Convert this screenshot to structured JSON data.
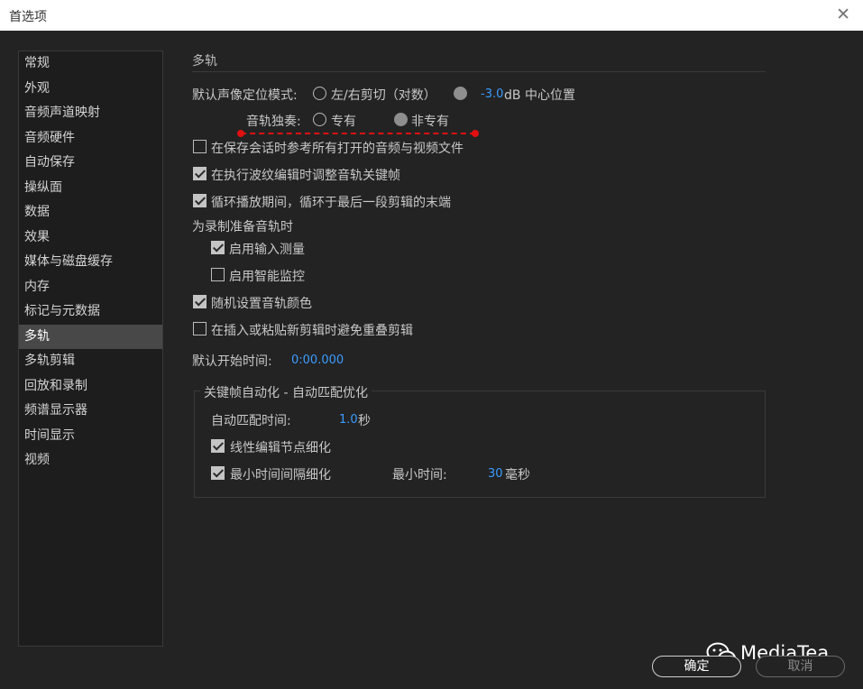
{
  "window": {
    "title": "首选项"
  },
  "sidebar": {
    "items": [
      {
        "label": "常规"
      },
      {
        "label": "外观"
      },
      {
        "label": "音频声道映射"
      },
      {
        "label": "音频硬件"
      },
      {
        "label": "自动保存"
      },
      {
        "label": "操纵面"
      },
      {
        "label": "数据"
      },
      {
        "label": "效果"
      },
      {
        "label": "媒体与磁盘缓存"
      },
      {
        "label": "内存"
      },
      {
        "label": "标记与元数据"
      },
      {
        "label": "多轨",
        "active": true
      },
      {
        "label": "多轨剪辑"
      },
      {
        "label": "回放和录制"
      },
      {
        "label": "频谱显示器"
      },
      {
        "label": "时间显示"
      },
      {
        "label": "视频"
      }
    ]
  },
  "main": {
    "section_title": "多轨",
    "pan_mode": {
      "label": "默认声像定位模式:",
      "option1": "左/右剪切（对数）",
      "option2_value": "-3.0",
      "option2_unit": "dB 中心位置",
      "selected": "option2"
    },
    "solo": {
      "label": "音轨独奏:",
      "option1": "专有",
      "option2": "非专有",
      "selected": "option2"
    },
    "checkboxes": {
      "save_session_ref": {
        "label": "在保存会话时参考所有打开的音频与视频文件",
        "checked": false
      },
      "ripple_edit": {
        "label": "在执行波纹编辑时调整音轨关键帧",
        "checked": true
      },
      "loop_playback": {
        "label": "循环播放期间，循环于最后一段剪辑的末端",
        "checked": true
      }
    },
    "record_prep": {
      "label": "为录制准备音轨时",
      "enable_input_meter": {
        "label": "启用输入测量",
        "checked": true
      },
      "enable_smart_monitor": {
        "label": "启用智能监控",
        "checked": false
      }
    },
    "random_track_color": {
      "label": "随机设置音轨颜色",
      "checked": true
    },
    "avoid_overlap": {
      "label": "在插入或粘贴新剪辑时避免重叠剪辑",
      "checked": false
    },
    "default_start_time": {
      "label": "默认开始时间:",
      "value": "0:00.000"
    },
    "keyframe_group": {
      "title": "关键帧自动化 - 自动匹配优化",
      "auto_match_time": {
        "label": "自动匹配时间:",
        "value": "1.0",
        "unit": "秒"
      },
      "linear_edit_refine": {
        "label": "线性编辑节点细化",
        "checked": true
      },
      "min_interval_refine": {
        "label": "最小时间间隔细化",
        "checked": true
      },
      "min_time": {
        "label": "最小时间:",
        "value": "30",
        "unit": "毫秒"
      }
    }
  },
  "footer": {
    "ok_label": "确定",
    "cancel_label": "取消"
  },
  "watermark": {
    "text": "MediaTea"
  },
  "colors": {
    "accent_value": "#3a9cff",
    "annotation": "#e01010",
    "active_item": "#484848"
  }
}
